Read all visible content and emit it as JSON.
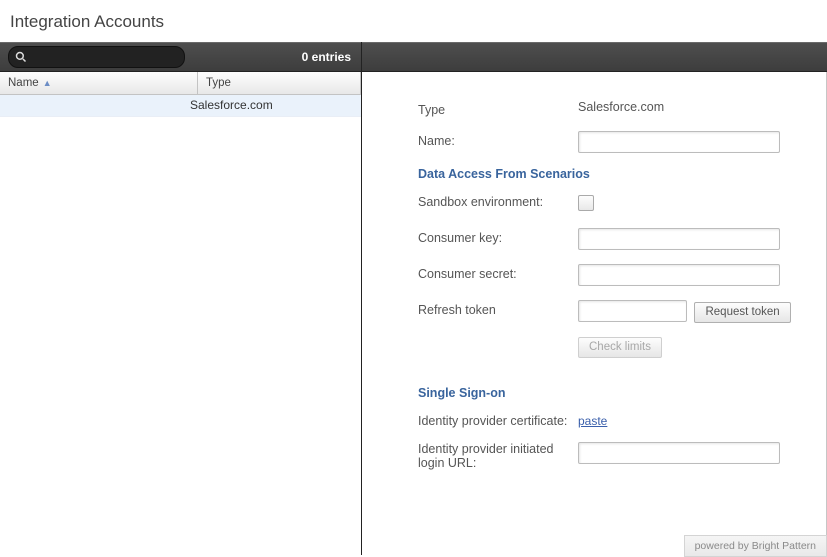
{
  "page_title": "Integration Accounts",
  "search": {
    "value": ""
  },
  "entries_label": "0 entries",
  "table": {
    "columns": {
      "name": "Name",
      "type": "Type"
    },
    "rows": [
      {
        "name": "",
        "type": "Salesforce.com"
      }
    ]
  },
  "form": {
    "type_label": "Type",
    "type_value": "Salesforce.com",
    "name_label": "Name:",
    "name_value": "",
    "section_data_access": "Data Access From Scenarios",
    "sandbox_label": "Sandbox environment:",
    "sandbox_checked": false,
    "consumer_key_label": "Consumer key:",
    "consumer_key_value": "",
    "consumer_secret_label": "Consumer secret:",
    "consumer_secret_value": "",
    "refresh_token_label": "Refresh token",
    "refresh_token_value": "",
    "request_token_btn": "Request token",
    "check_limits_btn": "Check limits",
    "section_sso": "Single Sign-on",
    "idp_cert_label": "Identity provider certificate:",
    "paste_link": "paste",
    "idp_login_url_label": "Identity provider initiated login URL:",
    "idp_login_url_value": ""
  },
  "footer": "powered by Bright Pattern"
}
